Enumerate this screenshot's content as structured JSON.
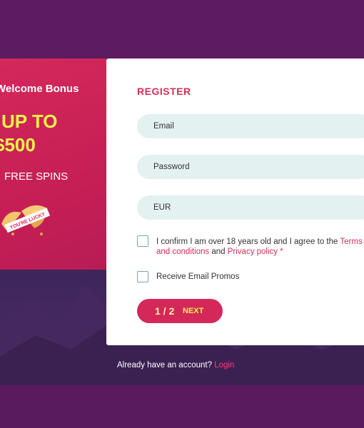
{
  "promo": {
    "bonus_label": "Welcome Bonus",
    "up_to": "UP TO",
    "amount": "$500",
    "free_spins": "FREE SPINS",
    "cookie_text": "YOU'RE LUCKY"
  },
  "register": {
    "title": "REGISTER",
    "email_placeholder": "Email",
    "password_placeholder": "Password",
    "currency_value": "EUR",
    "consent_text": "I confirm I am over 18 years old and I agree to the ",
    "terms_link": "Terms and conditions",
    "and_text": " and ",
    "privacy_link": "Privacy policy",
    "required_mark": " *",
    "email_promos_label": "Receive Email Promos",
    "step": "1 / 2",
    "next_label": "NEXT"
  },
  "footer": {
    "account_text": "Already have an account?",
    "login_link": "Login"
  },
  "colors": {
    "accent": "#d4285a",
    "highlight": "#f3f34a",
    "field_bg": "#e4f1f1",
    "background": "#5a1a5e"
  }
}
